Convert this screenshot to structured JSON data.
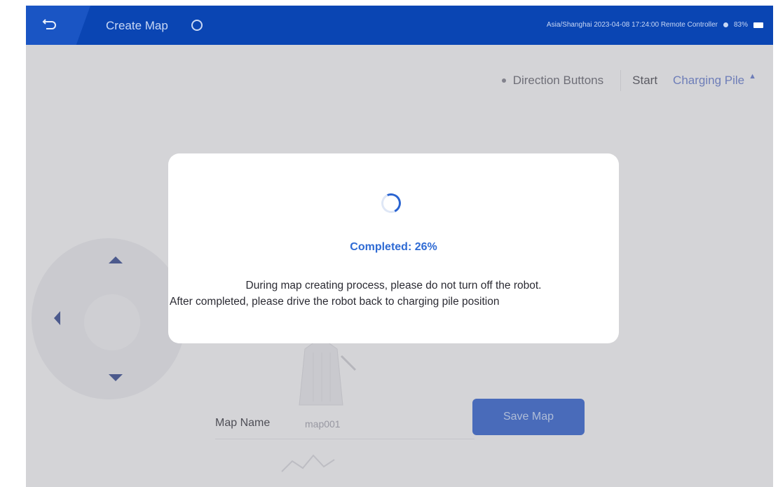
{
  "header": {
    "title": "Create Map",
    "status": "Asia/Shanghai 2023-04-08 17:24:00   Remote Controller",
    "battery": "83%"
  },
  "toolbar": {
    "direction_label": "Direction Buttons",
    "start_label": "Start",
    "charging_pile_label": "Charging Pile"
  },
  "map_form": {
    "name_label": "Map Name",
    "name_value": "map001",
    "save_label": "Save Map"
  },
  "dialog": {
    "progress_label": "Completed:  26%",
    "progress_percent": 26,
    "message_line1": "During map creating process, please do not turn off the robot.",
    "message_line2": "After completed, please drive the robot back to charging pile position"
  },
  "colors": {
    "header_bg": "#0a45b3",
    "accent": "#2f6bd4",
    "button_bg": "#2657c9"
  }
}
